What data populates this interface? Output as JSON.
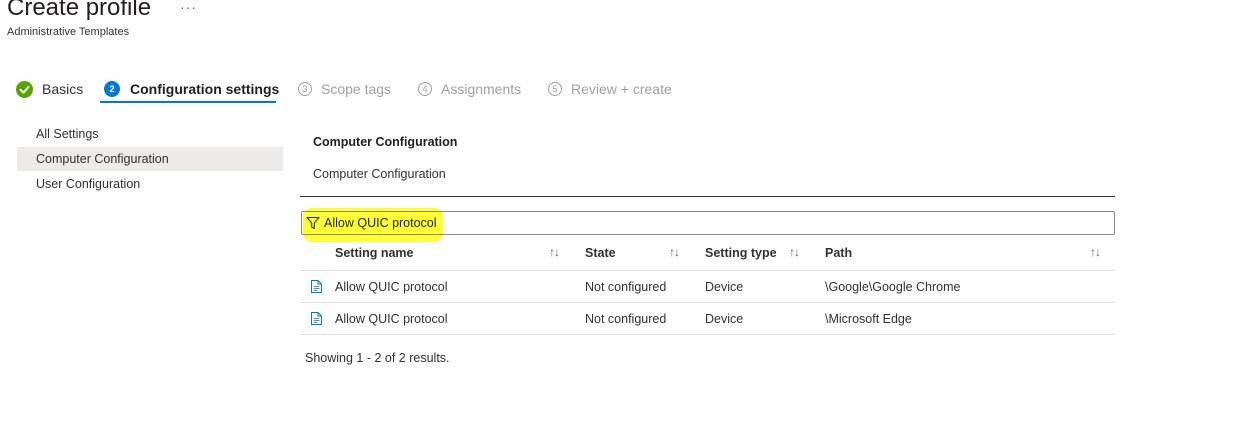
{
  "header": {
    "title": "Create profile",
    "more": "···",
    "subtitle": "Administrative Templates"
  },
  "steps": [
    {
      "number": "",
      "label": "Basics",
      "state": "completed"
    },
    {
      "number": "2",
      "label": "Configuration settings",
      "state": "active"
    },
    {
      "number": "3",
      "label": "Scope tags",
      "state": "disabled"
    },
    {
      "number": "4",
      "label": "Assignments",
      "state": "disabled"
    },
    {
      "number": "5",
      "label": "Review + create",
      "state": "disabled"
    }
  ],
  "nav": {
    "items": [
      {
        "label": "All Settings",
        "selected": false
      },
      {
        "label": "Computer Configuration",
        "selected": true
      },
      {
        "label": "User Configuration",
        "selected": false
      }
    ]
  },
  "main": {
    "heading": "Computer Configuration",
    "subheading": "Computer Configuration",
    "filter_value": "Allow QUIC protocol",
    "highlight_color": "#ffff33"
  },
  "table": {
    "columns": [
      "Setting name",
      "State",
      "Setting type",
      "Path"
    ],
    "sort_glyph": "↑↓",
    "rows": [
      {
        "icon": "document-icon",
        "name": "Allow QUIC protocol",
        "state": "Not configured",
        "type": "Device",
        "path": "\\Google\\Google Chrome"
      },
      {
        "icon": "document-icon",
        "name": "Allow QUIC protocol",
        "state": "Not configured",
        "type": "Device",
        "path": "\\Microsoft Edge"
      }
    ]
  },
  "results_text": "Showing 1 - 2 of 2 results.",
  "colors": {
    "accent": "#0078d4",
    "success": "#57a300",
    "selected_nav_bg": "#edebe9"
  }
}
